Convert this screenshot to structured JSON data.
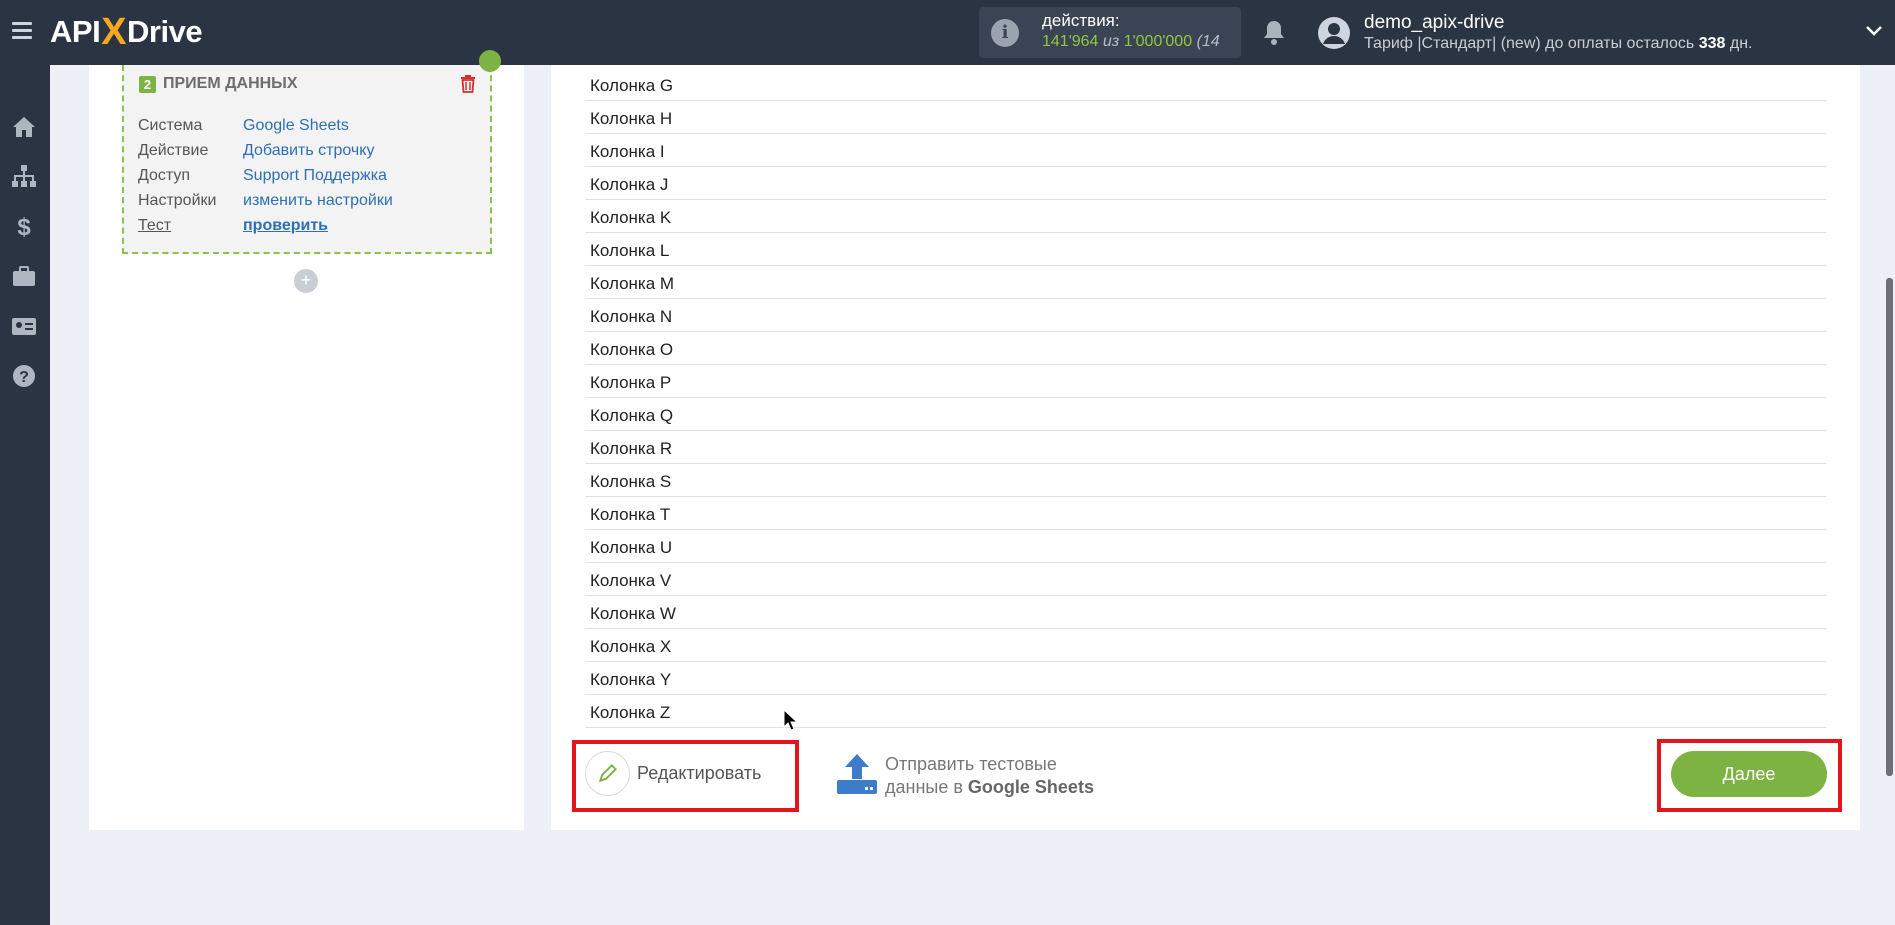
{
  "header": {
    "logo": {
      "left": "API",
      "x": "X",
      "right": "Drive"
    },
    "actions": {
      "label": "действия:",
      "used": "141'964",
      "of": "из",
      "total": "1'000'000",
      "extra": "(14"
    },
    "user": {
      "name": "demo_apix-drive",
      "plan_prefix": "Тариф |Стандарт| (new) до оплаты осталось",
      "days": "338",
      "days_suffix": "дн."
    }
  },
  "sidebar": {
    "items": [
      "home-icon",
      "sitemap-icon",
      "dollar-icon",
      "briefcase-icon",
      "id-card-icon",
      "help-icon"
    ]
  },
  "step": {
    "number": "2",
    "title": "ПРИЕМ ДАННЫХ",
    "rows": [
      {
        "label": "Система",
        "value": "Google Sheets"
      },
      {
        "label": "Действие",
        "value": "Добавить строчку"
      },
      {
        "label": "Доступ",
        "value": "Support Поддержка"
      },
      {
        "label": "Настройки",
        "value": "изменить настройки"
      },
      {
        "label": "Тест",
        "value": "проверить"
      }
    ],
    "add": "+"
  },
  "columns": [
    "Колонка G",
    "Колонка H",
    "Колонка I",
    "Колонка J",
    "Колонка K",
    "Колонка L",
    "Колонка M",
    "Колонка N",
    "Колонка O",
    "Колонка P",
    "Колонка Q",
    "Колонка R",
    "Колонка S",
    "Колонка T",
    "Колонка U",
    "Колонка V",
    "Колонка W",
    "Колонка X",
    "Колонка Y",
    "Колонка Z"
  ],
  "footer": {
    "edit_label": "Редактировать",
    "send_line1": "Отправить тестовые",
    "send_line2_prefix": "данные в",
    "send_line2_bold": "Google Sheets",
    "next_label": "Далее"
  },
  "colors": {
    "accent_green": "#7cb342",
    "highlight_red": "#e4141f",
    "topbar": "#2b3442",
    "link_blue": "#2d6fb5"
  }
}
